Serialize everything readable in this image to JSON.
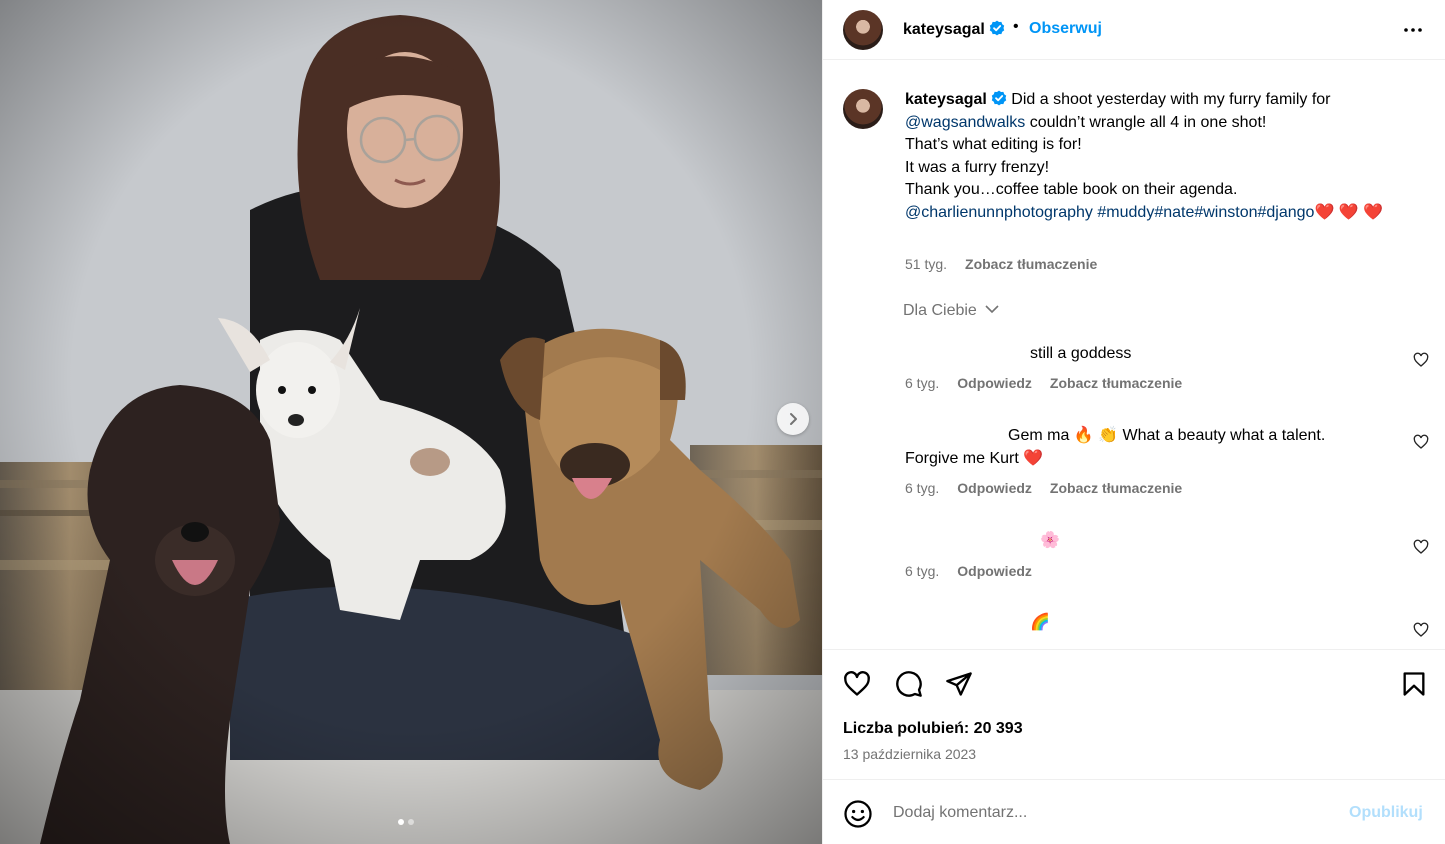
{
  "post": {
    "username": "kateysagal",
    "verified_icon": "verified-badge-icon",
    "separator": "•",
    "follow_label": "Obserwuj",
    "more_icon": "more-horizontal-icon",
    "media_next_icon": "chevron-right-icon",
    "carousel": {
      "count": 2,
      "active_index": 0
    }
  },
  "caption": {
    "username": "kateysagal",
    "line1": "Did a shoot yesterday with my furry family for",
    "mention1": "@wagsandwalks",
    "line2": "couldn’t wrangle all 4 in one shot!",
    "line3": "That’s what editing is for!",
    "line4": "It was a furry frenzy!",
    "line5": "Thank you…coffee table book on their agenda.",
    "mention2": "@charlienunnphotography",
    "hashtags": "#muddy#nate#winston#django",
    "hearts": "❤️ ❤️ ❤️",
    "time": "51 tyg.",
    "translate": "Zobacz tłumaczenie"
  },
  "sort": {
    "label": "Dla Ciebie",
    "icon": "chevron-down-icon"
  },
  "comments": [
    {
      "text": "still a goddess",
      "time": "6 tyg.",
      "reply": "Odpowiedz",
      "translate": "Zobacz tłumaczenie"
    },
    {
      "text_line1": "Gem ma 🔥 👏 What a beauty what a talent.",
      "text_line2": "Forgive me Kurt ❤️",
      "time": "6 tyg.",
      "reply": "Odpowiedz",
      "translate": "Zobacz tłumaczenie"
    },
    {
      "text": "🌸",
      "time": "6 tyg.",
      "reply": "Odpowiedz"
    },
    {
      "text": "🌈"
    }
  ],
  "actions": {
    "like_icon": "heart-icon",
    "comment_icon": "comment-icon",
    "share_icon": "share-icon",
    "save_icon": "bookmark-icon"
  },
  "likes_text": "Liczba polubień: 20 393",
  "date_text": "13 października 2023",
  "add_comment": {
    "emoji_icon": "emoji-icon",
    "placeholder": "Dodaj komentarz...",
    "publish_label": "Opublikuj"
  },
  "colors": {
    "link": "#00376b",
    "accent": "#0095f6",
    "muted": "#737373",
    "publish_disabled": "#b2dffc"
  }
}
